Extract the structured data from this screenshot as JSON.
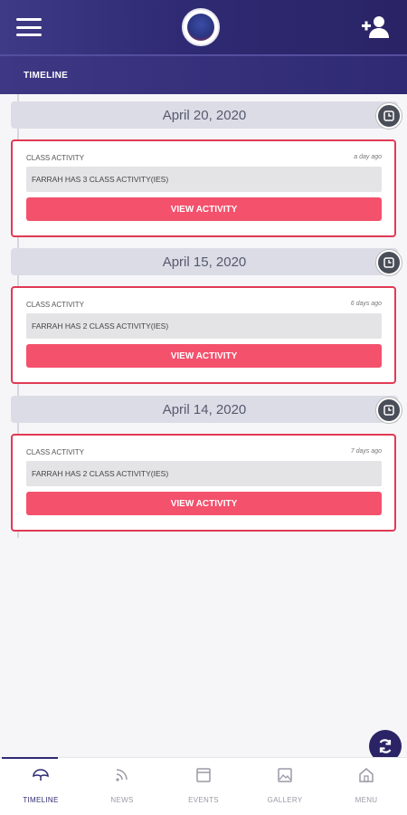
{
  "header": {
    "subtitle": "TIMELINE",
    "menu_icon": "hamburger-icon",
    "add_icon": "add-user-icon"
  },
  "timeline": [
    {
      "date": "April 20, 2020",
      "label": "CLASS ACTIVITY",
      "time": "a day ago",
      "message": "FARRAH HAS 3 CLASS ACTIVITY(IES)",
      "button": "VIEW ACTIVITY"
    },
    {
      "date": "April 15, 2020",
      "label": "CLASS ACTIVITY",
      "time": "6 days ago",
      "message": "FARRAH HAS 2 CLASS ACTIVITY(IES)",
      "button": "VIEW ACTIVITY"
    },
    {
      "date": "April 14, 2020",
      "label": "CLASS ACTIVITY",
      "time": "7 days ago",
      "message": "FARRAH HAS 2 CLASS ACTIVITY(IES)",
      "button": "VIEW ACTIVITY"
    }
  ],
  "tabs": [
    {
      "label": "TIMELINE",
      "icon": "umbrella-icon"
    },
    {
      "label": "NEWS",
      "icon": "rss-icon"
    },
    {
      "label": "EVENTS",
      "icon": "calendar-icon"
    },
    {
      "label": "GALLERY",
      "icon": "image-icon"
    },
    {
      "label": "MENU",
      "icon": "home-icon"
    }
  ],
  "colors": {
    "header": "#2f2a73",
    "accent": "#f4516c",
    "card_border": "#e03a55"
  }
}
